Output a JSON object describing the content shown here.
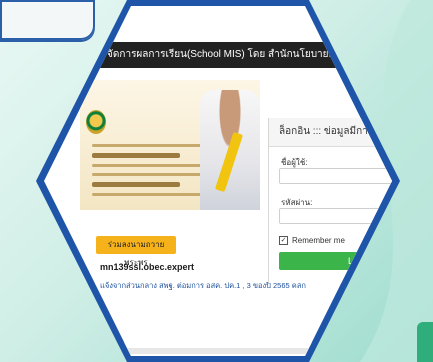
{
  "window": {
    "title": "การจัดการผลการเรียน(School MIS) โดย สำนักนโยบายและแผน"
  },
  "banner": {
    "image": "portrait-banner"
  },
  "announcement": {
    "button_label": "ร่วมลงนามถวายพระพร"
  },
  "server": {
    "text": "mn139ssl.obec.expert",
    "note": "แจ้งจากส่วนกลาง สพฐ. ต่อมการ อสค. ปค.1 , 3 ของปี 2565 คลิก",
    "link": "คลิก"
  },
  "login": {
    "header": "ล็อกอิน ::: ข่อมูลมีการศึกษา",
    "username_label": "ชื่อผู้ใช้:",
    "password_label": "รหัสผ่าน:",
    "username_value": "",
    "password_value": "",
    "remember_label": "Remember me",
    "remember_checked": true,
    "login_button": "Login"
  },
  "colors": {
    "hex_border": "#1e55a8",
    "titlebar": "#222222",
    "login_button": "#3bb54a",
    "announce_button": "#f6b21b"
  }
}
